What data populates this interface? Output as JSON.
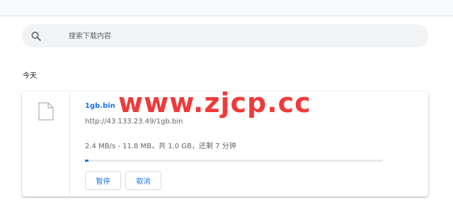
{
  "search": {
    "placeholder": "搜索下载内容"
  },
  "date_header": "今天",
  "download": {
    "file_name": "1gb.bin",
    "url": "http://43.133.23.49/1gb.bin",
    "status": "2.4 MB/s - 11.8 MB，共 1.0 GB，还剩 7 分钟",
    "progress_fraction": 0.0115,
    "pause_label": "暂停",
    "cancel_label": "取消"
  },
  "watermark": "www.zjcp.cc",
  "colors": {
    "accent": "#1a73e8",
    "watermark": "#f03a3a",
    "search_bg": "#f1f3f4"
  },
  "icons": {
    "search": "search-icon",
    "file": "file-icon"
  }
}
